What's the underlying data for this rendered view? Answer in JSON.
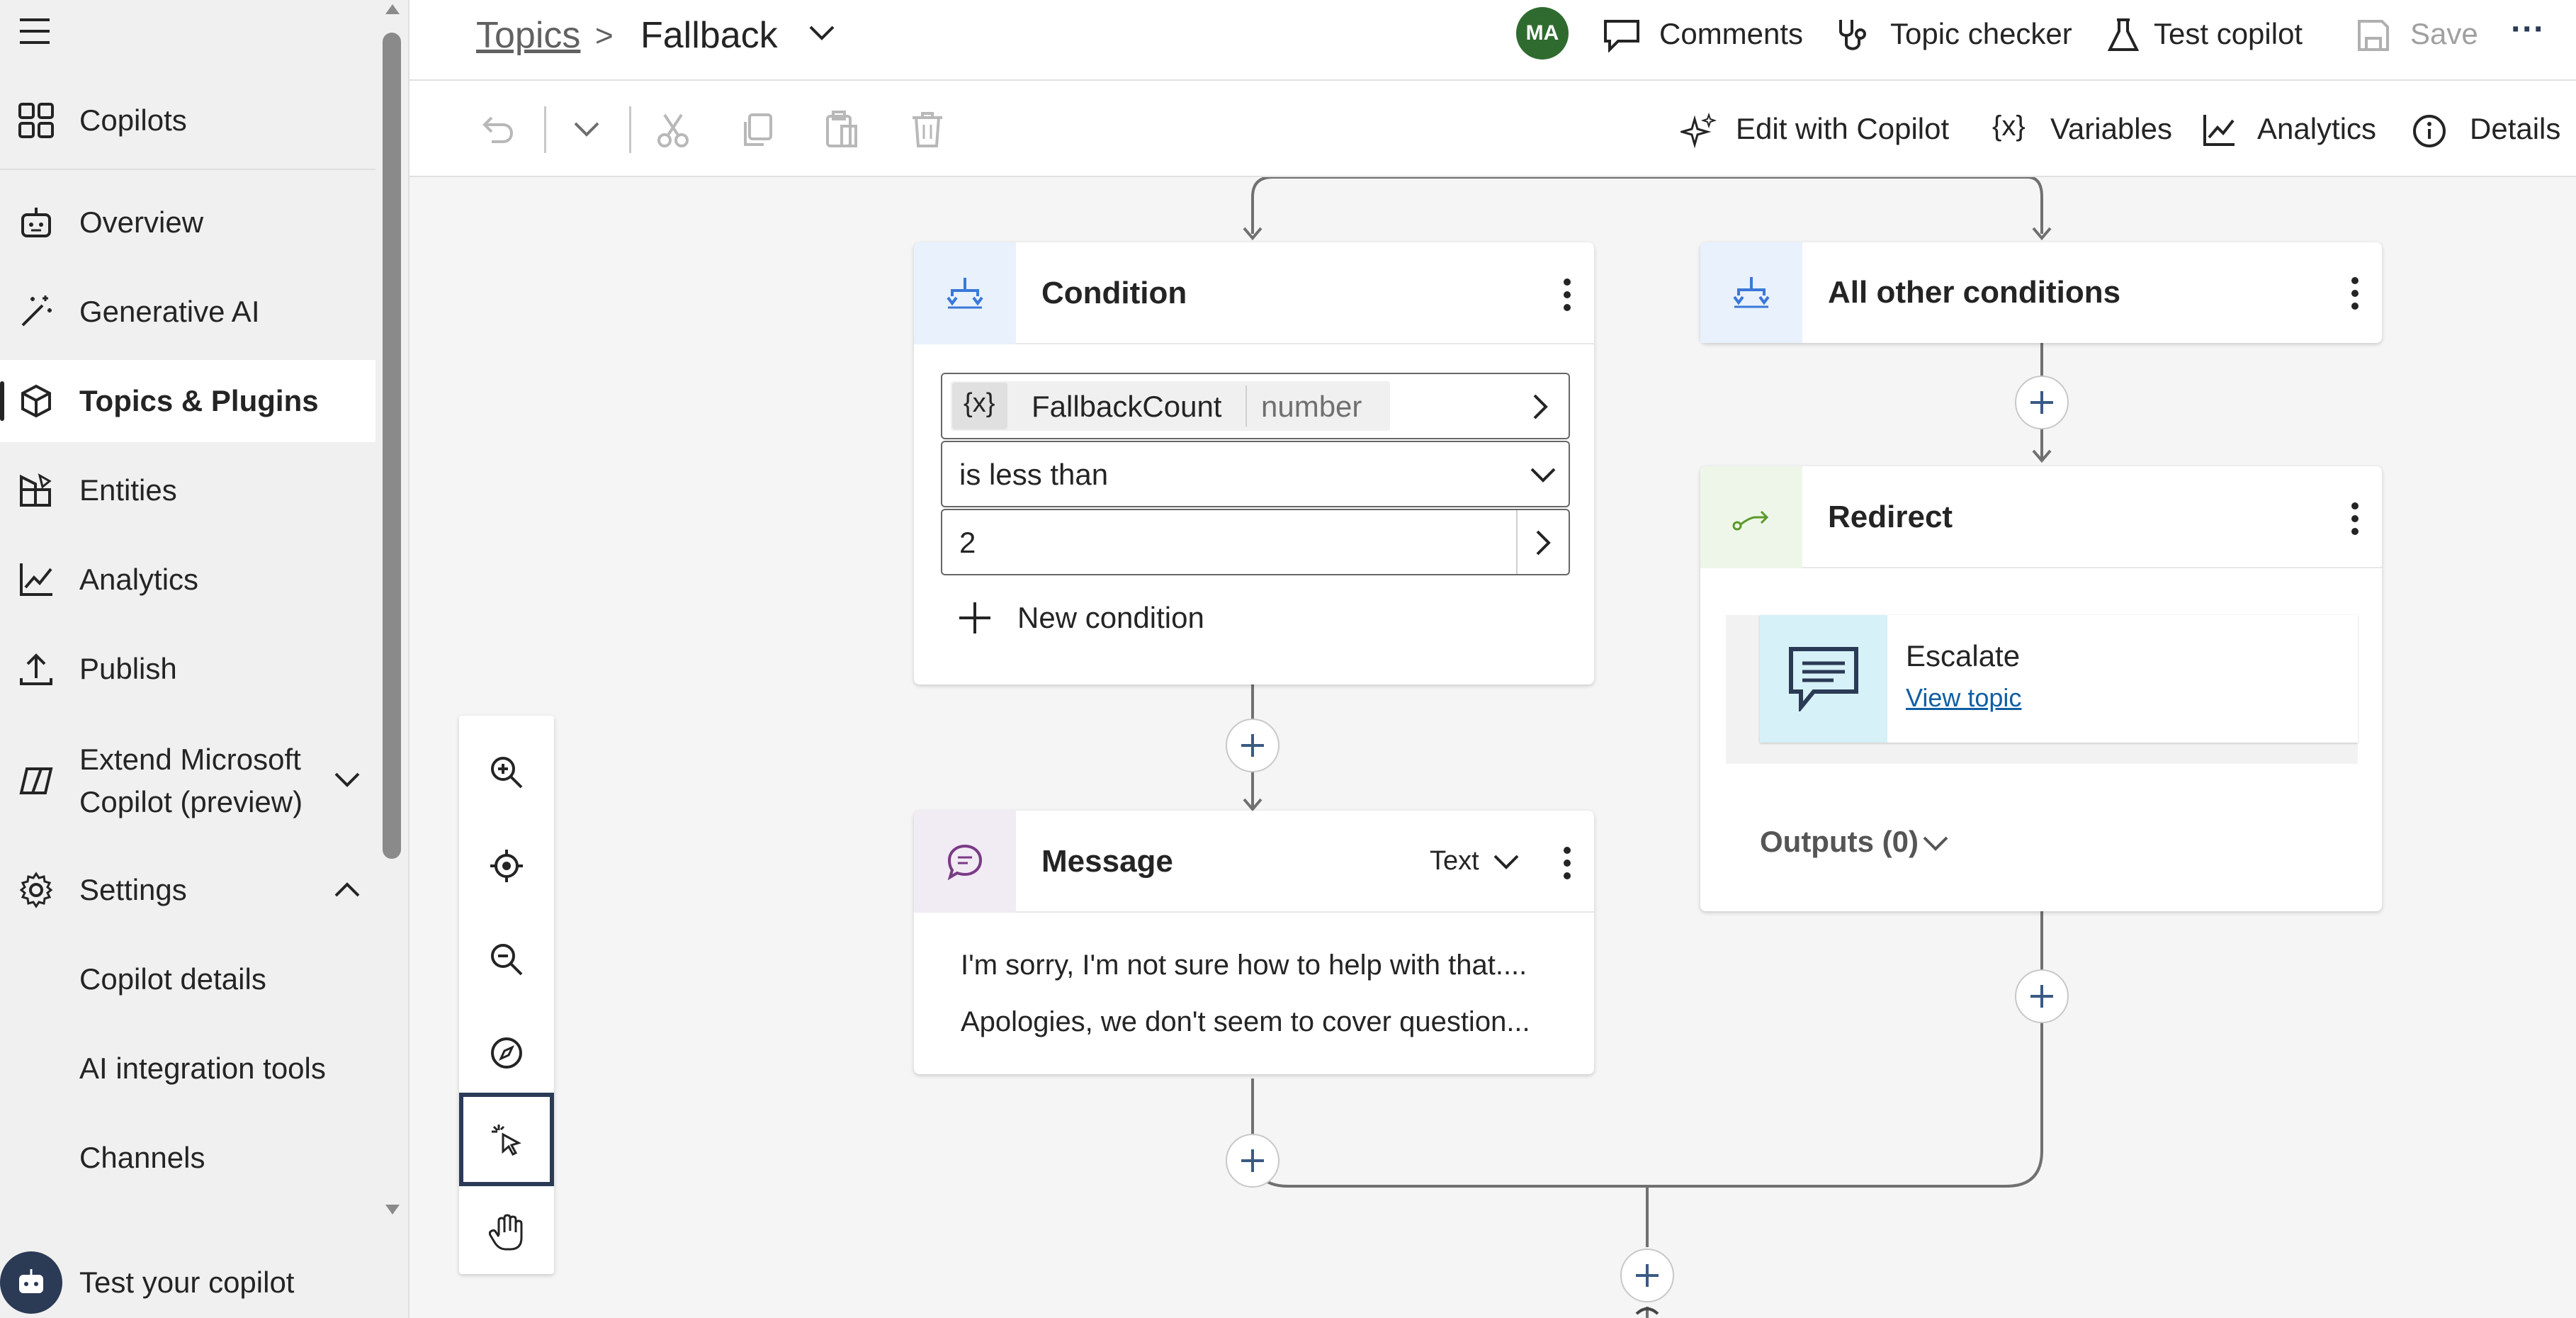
{
  "sidebar": {
    "items": [
      {
        "label": "Copilots",
        "icon": "grid-icon"
      },
      {
        "label": "Overview",
        "icon": "bot-icon"
      },
      {
        "label": "Generative AI",
        "icon": "magic-wand-icon"
      },
      {
        "label": "Topics & Plugins",
        "icon": "cube-icon",
        "active": true
      },
      {
        "label": "Entities",
        "icon": "shapes-icon"
      },
      {
        "label": "Analytics",
        "icon": "chart-line-icon"
      },
      {
        "label": "Publish",
        "icon": "upload-icon"
      },
      {
        "label": "Extend Microsoft",
        "label2": "Copilot (preview)",
        "icon": "copilot-icon"
      },
      {
        "label": "Settings",
        "icon": "gear-icon"
      }
    ],
    "sub_items": [
      "Copilot details",
      "AI integration tools",
      "Channels"
    ],
    "test_label": "Test your copilot"
  },
  "header": {
    "breadcrumb_root": "Topics",
    "breadcrumb_sep": ">",
    "topic_name": "Fallback",
    "avatar": "MA",
    "comments": "Comments",
    "topic_checker": "Topic checker",
    "test_copilot": "Test copilot",
    "save": "Save",
    "more": "···"
  },
  "toolbar": {
    "edit_with_copilot": "Edit with Copilot",
    "variables": "Variables",
    "analytics": "Analytics",
    "details": "Details"
  },
  "canvas": {
    "condition": {
      "title": "Condition",
      "var_icon": "{x}",
      "variable": "FallbackCount",
      "var_type": "number",
      "operator": "is less than",
      "value": "2",
      "new_condition": "New condition"
    },
    "other_conditions": {
      "title": "All other conditions"
    },
    "redirect": {
      "title": "Redirect",
      "topic": "Escalate",
      "view_topic": "View topic",
      "outputs": "Outputs (0)"
    },
    "message": {
      "title": "Message",
      "mode": "Text",
      "line1": "I'm sorry, I'm not sure how to help with that....",
      "line2": "Apologies, we don't seem to cover question..."
    }
  },
  "colors": {
    "accent_link": "#115ea3",
    "avatar_bg": "#2f6b2f",
    "condition_icon_bg": "#e8f1fc",
    "redirect_icon_bg": "#eef6e9",
    "message_icon_bg": "#f1ebf4",
    "escalate_icon_bg": "#d6f1f7"
  }
}
